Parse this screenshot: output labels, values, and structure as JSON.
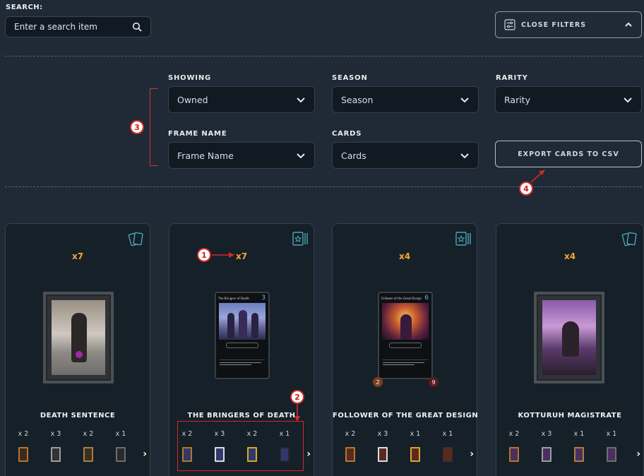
{
  "search": {
    "label": "SEARCH:",
    "placeholder": "Enter a search item"
  },
  "filters": {
    "close_label": "CLOSE FILTERS",
    "showing": {
      "label": "SHOWING",
      "value": "Owned"
    },
    "season": {
      "label": "SEASON",
      "value": "Season"
    },
    "rarity": {
      "label": "RARITY",
      "value": "Rarity"
    },
    "frame_name": {
      "label": "FRAME NAME",
      "value": "Frame Name"
    },
    "cards": {
      "label": "CARDS",
      "value": "Cards"
    },
    "export_label": "EXPORT CARDS TO CSV"
  },
  "annotations": [
    "1",
    "2",
    "3",
    "4"
  ],
  "cards": [
    {
      "name": "DEATH SENTENCE",
      "count": "x7",
      "icon": "card-stack-icon",
      "variants": [
        {
          "qty": "x 2",
          "color": "#b8742d"
        },
        {
          "qty": "x 3",
          "color": "#9d9d9d"
        },
        {
          "qty": "x 2",
          "color": "#b07d3a"
        },
        {
          "qty": "x 1",
          "color": "#6d6d6d"
        }
      ]
    },
    {
      "name": "THE BRINGERS OF DEATH",
      "count": "x7",
      "icon": "frame-star-icon",
      "mini_title": "The Bringers of Death",
      "mini_cost": "3",
      "variants": [
        {
          "qty": "x 2",
          "color": "#b8742d"
        },
        {
          "qty": "x 3",
          "color": "#d9dde3"
        },
        {
          "qty": "x 2",
          "color": "#d9a62a"
        },
        {
          "qty": "x 1",
          "color": "#222830"
        }
      ]
    },
    {
      "name": "FOLLOWER OF THE GREAT DESIGN",
      "count": "x4",
      "icon": "frame-star-icon",
      "mini_title": "Follower of the Great Design",
      "mini_cost": "6",
      "attack": "2",
      "health": "9",
      "variants": [
        {
          "qty": "x 2",
          "color": "#b8742d"
        },
        {
          "qty": "x 3",
          "color": "#d9dde3"
        },
        {
          "qty": "x 1",
          "color": "#d9a62a"
        },
        {
          "qty": "x 1",
          "color": "#4a2a2a"
        }
      ]
    },
    {
      "name": "KOTTURUH MAGISTRATE",
      "count": "x4",
      "icon": "card-stack-icon",
      "variants": [
        {
          "qty": "x 2",
          "color": "#b8742d"
        },
        {
          "qty": "x 3",
          "color": "#9d9d9d"
        },
        {
          "qty": "x 1",
          "color": "#b07d3a"
        },
        {
          "qty": "x 1",
          "color": "#6d6d6d"
        }
      ]
    }
  ],
  "colors": {
    "accent_count": "#f3a733",
    "annotation": "#d42828",
    "background": "#1f2a36"
  }
}
